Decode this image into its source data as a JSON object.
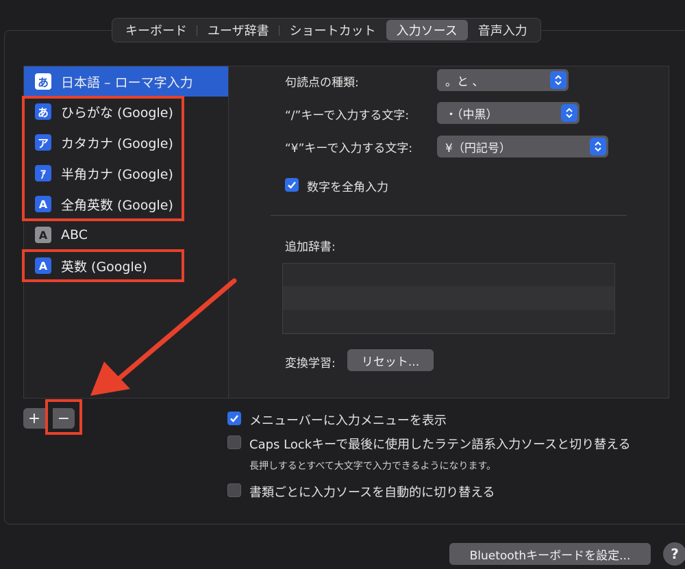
{
  "tabs": [
    {
      "label": "キーボード",
      "active": false
    },
    {
      "label": "ユーザ辞書",
      "active": false
    },
    {
      "label": "ショートカット",
      "active": false
    },
    {
      "label": "入力ソース",
      "active": true
    },
    {
      "label": "音声入力",
      "active": false
    }
  ],
  "sources": [
    {
      "icon": "あ",
      "label": "日本語 – ローマ字入力",
      "selected": true
    },
    {
      "icon": "あ",
      "label": "ひらがな (Google)"
    },
    {
      "icon": "ア",
      "label": "カタカナ (Google)"
    },
    {
      "icon": "ｱ",
      "label": "半角カナ (Google)"
    },
    {
      "icon": "A",
      "label": "全角英数 (Google)"
    },
    {
      "icon": "A",
      "label": "ABC"
    },
    {
      "icon": "A",
      "label": "英数 (Google)"
    }
  ],
  "settings": {
    "punctuation_label": "句読点の種類:",
    "punctuation_value": "。と 、",
    "slash_label": "“/”キーで入力する文字:",
    "slash_value": "・（中黒）",
    "yen_label": "“¥”キーで入力する文字:",
    "yen_value": "¥（円記号）",
    "fullwidth_numbers_label": "数字を全角入力",
    "fullwidth_numbers_checked": true,
    "extra_dict_label": "追加辞書:",
    "learning_label": "変換学習:",
    "reset_button": "リセット..."
  },
  "options": {
    "show_menu_label": "メニューバーに入力メニューを表示",
    "show_menu_checked": true,
    "caps_lock_label": "Caps Lockキーで最後に使用したラテン語系入力ソースと切り替える",
    "caps_lock_checked": false,
    "caps_lock_hint": "長押しするとすべて大文字で入力できるようになります。",
    "auto_switch_label": "書類ごとに入力ソースを自動的に切り替える",
    "auto_switch_checked": false
  },
  "buttons": {
    "add": "+",
    "remove": "−",
    "bluetooth": "Bluetoothキーボードを設定...",
    "help": "?"
  },
  "colors": {
    "accent": "#2f6ee8",
    "selection": "#2a5fd0",
    "annotation": "#e8412b"
  }
}
